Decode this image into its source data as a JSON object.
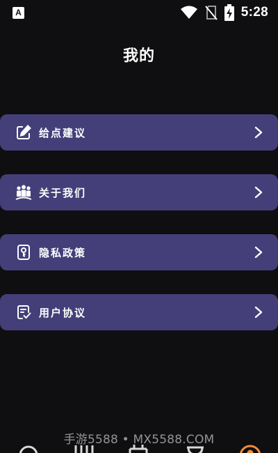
{
  "status_bar": {
    "time": "5:28",
    "notification_icon": "A"
  },
  "page": {
    "title": "我的"
  },
  "menu": {
    "items": [
      {
        "label": "给点建议",
        "icon": "edit-icon"
      },
      {
        "label": "关于我们",
        "icon": "group-icon"
      },
      {
        "label": "隐私政策",
        "icon": "privacy-lock-icon"
      },
      {
        "label": "用户协议",
        "icon": "agreement-check-icon"
      }
    ]
  },
  "watermark": "手游5588 • MX5588.COM",
  "bottom_nav": {
    "items": [
      {
        "icon": "clock-icon"
      },
      {
        "icon": "grid-icon"
      },
      {
        "icon": "calendar-icon"
      },
      {
        "icon": "cup-icon"
      },
      {
        "icon": "profile-icon",
        "active": true
      }
    ],
    "active_color": "#f28b3a"
  },
  "colors": {
    "background": "#0f0e10",
    "menu_item": "#443f79",
    "text": "#ffffff"
  }
}
